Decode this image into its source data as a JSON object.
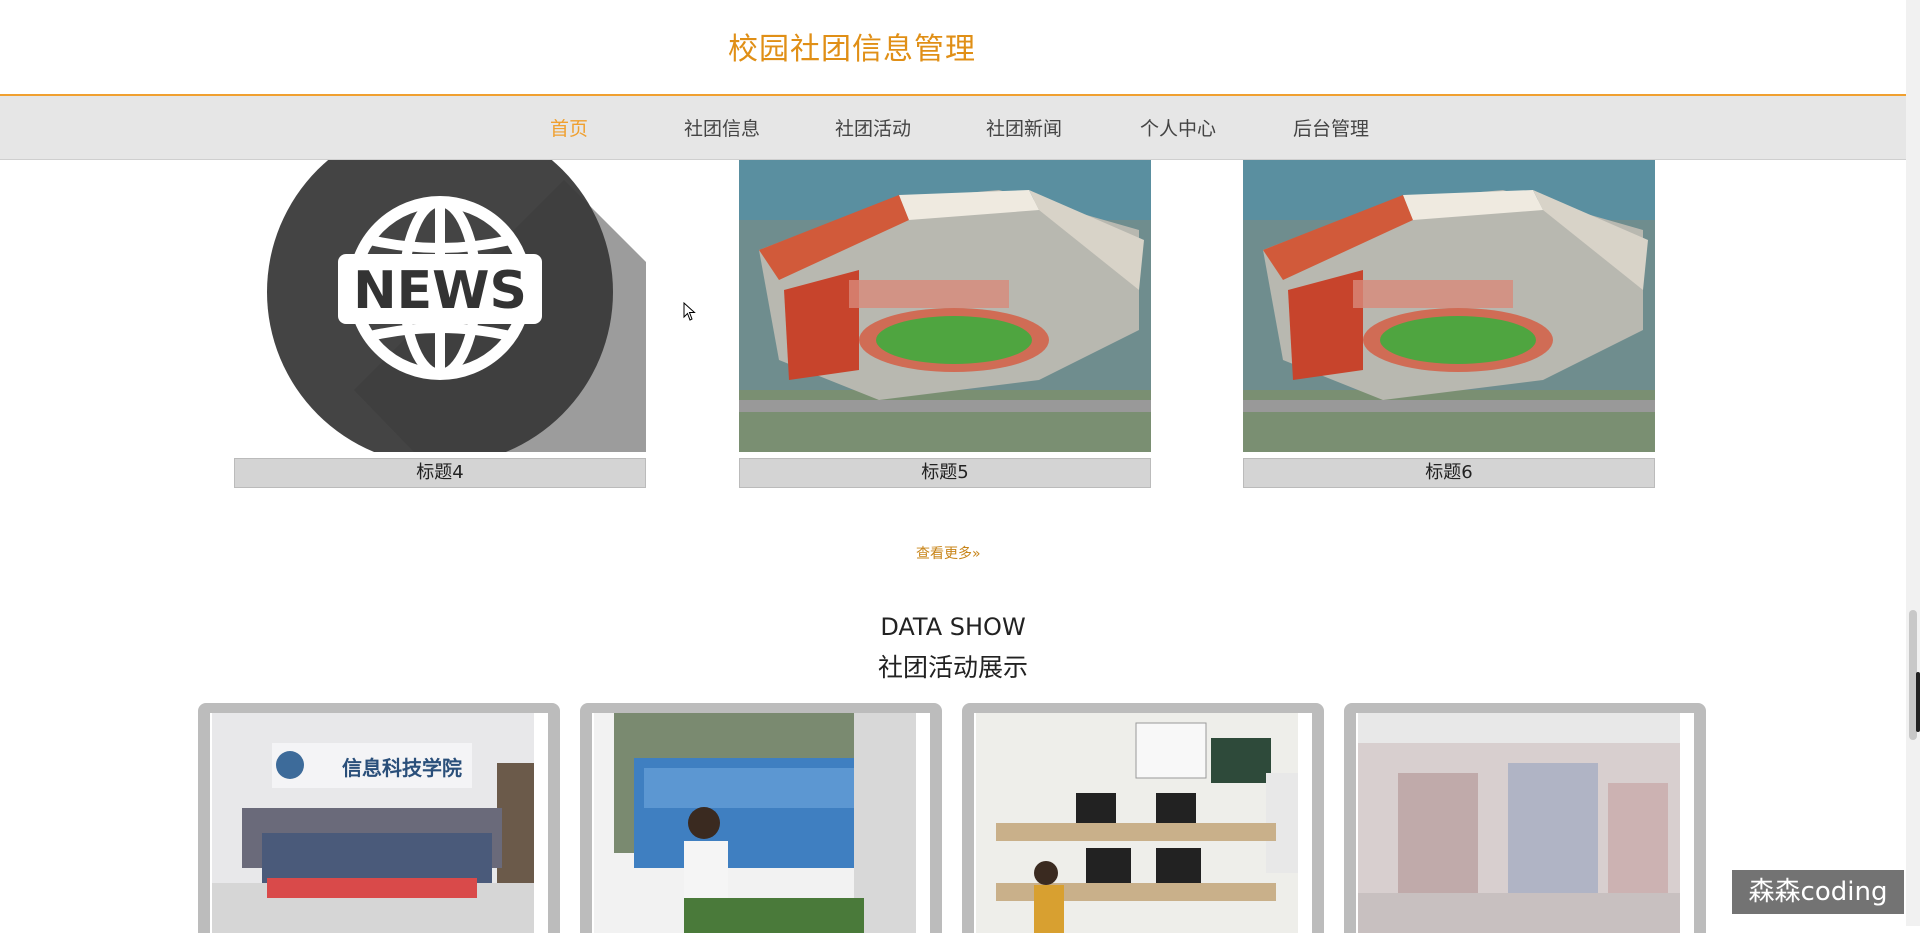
{
  "header": {
    "site_title": "校园社团信息管理"
  },
  "nav": {
    "items": [
      {
        "label": "首页",
        "active": true
      },
      {
        "label": "社团信息",
        "active": false
      },
      {
        "label": "社团活动",
        "active": false
      },
      {
        "label": "社团新闻",
        "active": false
      },
      {
        "label": "个人中心",
        "active": false
      },
      {
        "label": "后台管理",
        "active": false
      }
    ]
  },
  "news_cards": [
    {
      "caption": "标题4",
      "image": "news-globe-icon"
    },
    {
      "caption": "标题5",
      "image": "campus-aerial-photo"
    },
    {
      "caption": "标题6",
      "image": "campus-aerial-photo"
    }
  ],
  "news_icon_text": "NEWS",
  "more_link": "查看更多",
  "activity_section": {
    "title_en": "DATA SHOW",
    "title_cn": "社团活动展示",
    "photo_texts": [
      "信息科技学院"
    ]
  },
  "watermark": "森森coding",
  "colors": {
    "accent": "#f0a030",
    "nav_bg": "#e6e6e6",
    "caption_bg": "#d4d4d4"
  }
}
